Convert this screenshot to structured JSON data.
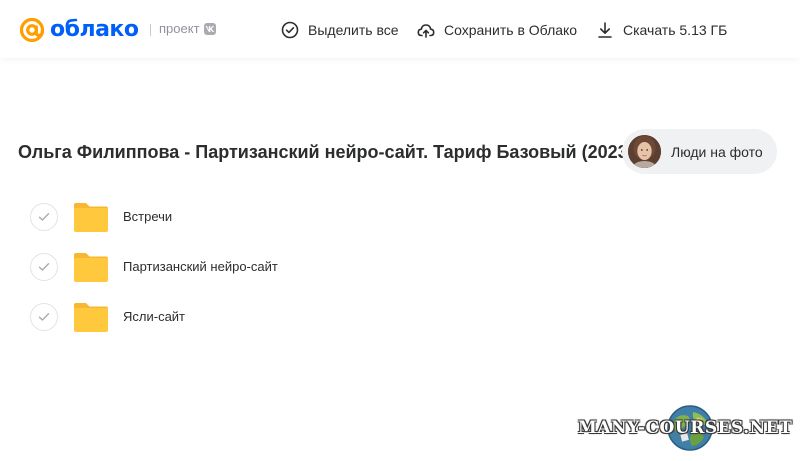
{
  "header": {
    "brand": "облако",
    "project_label": "проект",
    "actions": {
      "select_all": "Выделить все",
      "save_to_cloud": "Сохранить в Облако",
      "download": "Скачать 5.13 ГБ"
    }
  },
  "main": {
    "title": "Ольга Филиппова - Партизанский нейро-сайт. Тариф Базовый (2023)",
    "people_button": "Люди на фото",
    "folders": [
      {
        "name": "Встречи"
      },
      {
        "name": "Партизанский нейро-сайт"
      },
      {
        "name": "Ясли-сайт"
      }
    ]
  },
  "watermark": {
    "text": "MANY-COURSES.NET"
  },
  "colors": {
    "brand_blue": "#005ff9",
    "logo_orange": "#ff9e00",
    "folder_yellow": "#ffc83d",
    "folder_tab": "#f7b731"
  },
  "icons": [
    "at-sign-logo-icon",
    "vk-icon",
    "check-circle-icon",
    "cloud-upload-icon",
    "download-icon",
    "checkmark-icon",
    "folder-icon",
    "globe-icon"
  ]
}
